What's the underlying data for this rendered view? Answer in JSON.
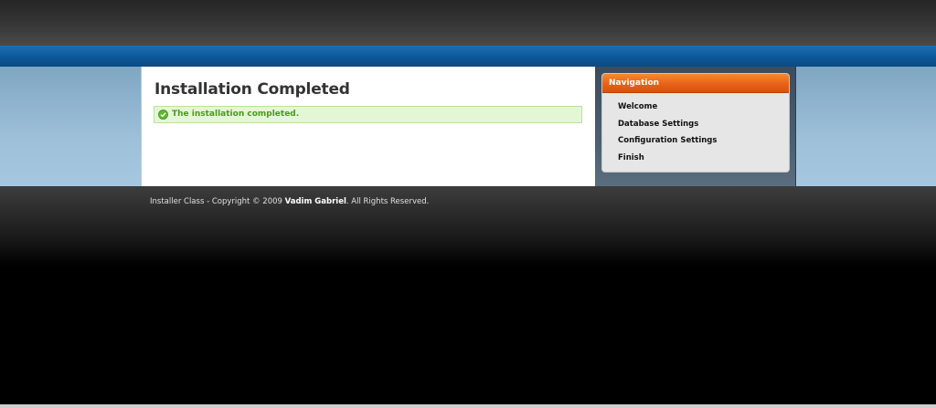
{
  "main": {
    "title": "Installation Completed",
    "message": "The installation completed."
  },
  "navigation": {
    "title": "Navigation",
    "items": [
      {
        "label": "Welcome"
      },
      {
        "label": "Database Settings"
      },
      {
        "label": "Configuration Settings"
      },
      {
        "label": "Finish"
      }
    ]
  },
  "footer": {
    "prefix": "Installer Class - Copyright © 2009 ",
    "author": "Vadim Gabriel",
    "suffix": ". All Rights Reserved."
  },
  "colors": {
    "nav_header": "#e8621a",
    "success_text": "#4a9a1f",
    "success_bg": "#e3f7d6",
    "blue_bar": "#0d5a9c"
  },
  "icons": {
    "success": "check-circle-icon"
  }
}
